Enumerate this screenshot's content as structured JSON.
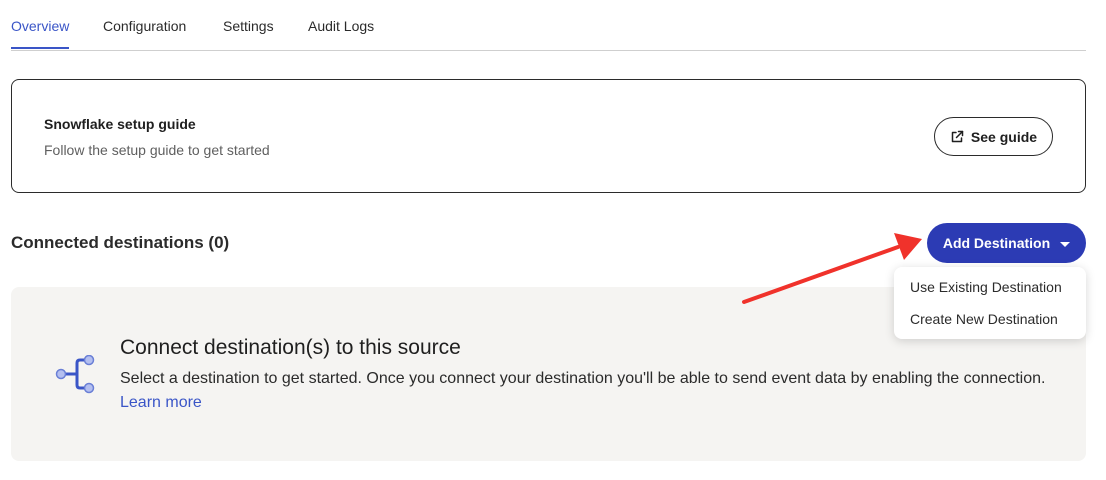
{
  "tabs": [
    {
      "label": "Overview",
      "active": true
    },
    {
      "label": "Configuration",
      "active": false
    },
    {
      "label": "Settings",
      "active": false
    },
    {
      "label": "Audit Logs",
      "active": false
    }
  ],
  "guide": {
    "title": "Snowflake setup guide",
    "subtitle": "Follow the setup guide to get started",
    "button_label": "See guide",
    "button_icon": "external-link-icon"
  },
  "destinations": {
    "section_title": "Connected destinations (0)",
    "add_button_label": "Add Destination",
    "menu_items": [
      "Use Existing Destination",
      "Create New Destination"
    ]
  },
  "empty_state": {
    "icon": "connection-icon",
    "title": "Connect destination(s) to this source",
    "description": "Select a destination to get started. Once you connect your destination you'll be able to send event data by enabling the connection.",
    "link_label": "Learn more"
  },
  "colors": {
    "accent": "#3a55c7",
    "primary_button": "#2c3bb4",
    "panel_bg": "#f5f4f2",
    "annotation_arrow": "#f0322b"
  }
}
